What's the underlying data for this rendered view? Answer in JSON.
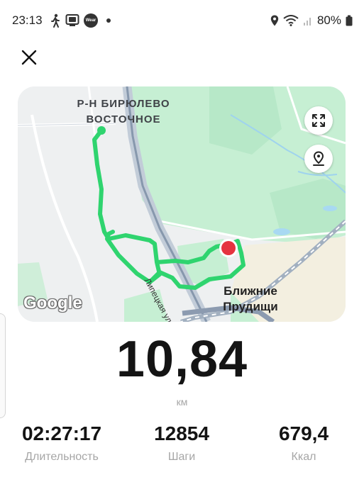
{
  "status_bar": {
    "time": "23:13",
    "left_icons": [
      "walking-icon",
      "screen-mirror-icon",
      "wear-icon"
    ],
    "wear_label": "Wear",
    "battery": "80%"
  },
  "map": {
    "district_label_line1": "Р-Н БИРЮЛЕВО",
    "district_label_line2": "ВОСТОЧНОЕ",
    "place_label_line1": "Ближние",
    "place_label_line2": "Прудищи",
    "street_label": "Липецкая ул.",
    "provider": "Google",
    "route_color": "#2fd46f",
    "end_marker_color": "#e5333f"
  },
  "summary": {
    "distance": "10,84",
    "distance_unit": "км",
    "duration": "02:27:17",
    "duration_label": "Длительность",
    "steps": "12854",
    "steps_label": "Шаги",
    "kcal": "679,4",
    "kcal_label": "Ккал"
  }
}
